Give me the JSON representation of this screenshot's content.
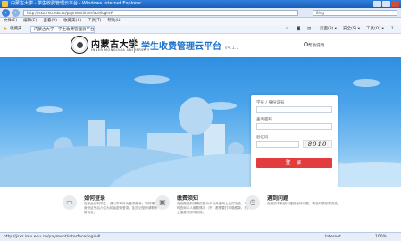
{
  "window": {
    "title": "内蒙古大学 - 学生收费管理云平台 - Windows Internet Explorer"
  },
  "address_bar": {
    "url": "http://jsxz.imu.edu.cn/payment/interface/login#",
    "search_placeholder": "Bing"
  },
  "menu": {
    "items": [
      "文件(F)",
      "编辑(E)",
      "查看(V)",
      "收藏夹(A)",
      "工具(T)",
      "帮助(H)"
    ]
  },
  "favorites_bar": {
    "favorites_label": "收藏夹",
    "tab_title": "内蒙古大学 - 学生收费管理云平台",
    "page_menu": "页面(P) ▾",
    "safety_menu": "安全(S) ▾",
    "tools_menu": "工具(O) ▾",
    "help_menu": "?"
  },
  "header": {
    "logo_cn": "内蒙古大学",
    "logo_en": "INNER MONGOLIA UNIVERSITY",
    "app_title": "学生收费管理云平台",
    "version": "V4.1.1",
    "help_link": "帮助说明"
  },
  "login": {
    "username_label": "学号 / 身份证号",
    "password_label": "查询密码",
    "captcha_label": "验证码",
    "captcha_code": "8010",
    "submit_label": "登 录"
  },
  "features": [
    {
      "icon": "user-card-icon",
      "title": "如何登录",
      "text": "在读全日制学生，请以学号作为登录账号；同时确认身份证号后六位为初始密码登录，如忘记密码请联系财务处。"
    },
    {
      "icon": "box-icon",
      "title": "缴费须知",
      "text": "在线缴费前请确保银行卡已开通网上支付功能，可随时查询本人缴费情况（不）都需要打印缴费单，在网上缴费可即时到账。"
    },
    {
      "icon": "clock-icon",
      "title": "遇到问题",
      "text": "在使用本系统中遇到任何问题，请及时联系财务处。"
    }
  ],
  "status_bar": {
    "url": "http://jsxz.imu.edu.cn/payment/interface/login#",
    "zone": "Internet",
    "zoom": "100%"
  },
  "colors": {
    "title_bar": "#1f6ac8",
    "brand_blue": "#1e73c8",
    "login_button": "#e23c3c",
    "banner_sky": "#4aa3ea"
  }
}
